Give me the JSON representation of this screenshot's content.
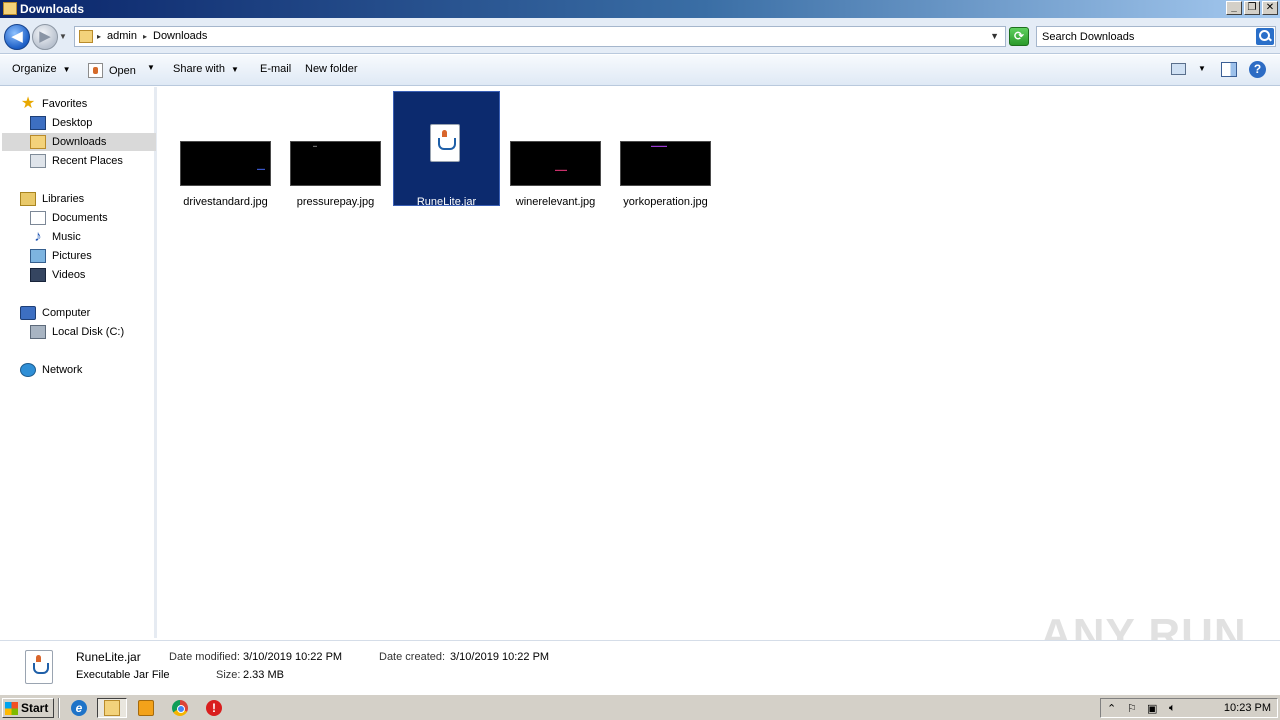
{
  "window": {
    "title": "Downloads",
    "controls": [
      "_",
      "❐",
      "✕"
    ]
  },
  "address": {
    "crumbs": [
      "admin",
      "Downloads"
    ],
    "search_placeholder": "Search Downloads"
  },
  "toolbar": {
    "organize": "Organize",
    "open": "Open",
    "share_with": "Share with",
    "email": "E-mail",
    "new_folder": "New folder"
  },
  "sidebar": {
    "favorites": "Favorites",
    "desktop": "Desktop",
    "downloads": "Downloads",
    "recent_places": "Recent Places",
    "libraries": "Libraries",
    "documents": "Documents",
    "music": "Music",
    "pictures": "Pictures",
    "videos": "Videos",
    "computer": "Computer",
    "local_disk": "Local Disk (C:)",
    "network": "Network",
    "selected": "downloads"
  },
  "files": [
    {
      "name": "drivestandard.jpg",
      "type": "image"
    },
    {
      "name": "pressurepay.jpg",
      "type": "image"
    },
    {
      "name": "RuneLite.jar",
      "type": "jar",
      "selected": true
    },
    {
      "name": "winerelevant.jpg",
      "type": "image"
    },
    {
      "name": "yorkoperation.jpg",
      "type": "image"
    }
  ],
  "details": {
    "name": "RuneLite.jar",
    "type": "Executable Jar File",
    "date_modified_label": "Date modified:",
    "date_modified": "3/10/2019 10:22 PM",
    "date_created_label": "Date created:",
    "date_created": "3/10/2019 10:22 PM",
    "size_label": "Size:",
    "size": "2.33 MB"
  },
  "watermark": "ANY RUN",
  "taskbar": {
    "start": "Start",
    "clock": "10:23 PM"
  },
  "colors": {
    "selection": "#0c2a6e",
    "title_bar": "#0a246a"
  }
}
